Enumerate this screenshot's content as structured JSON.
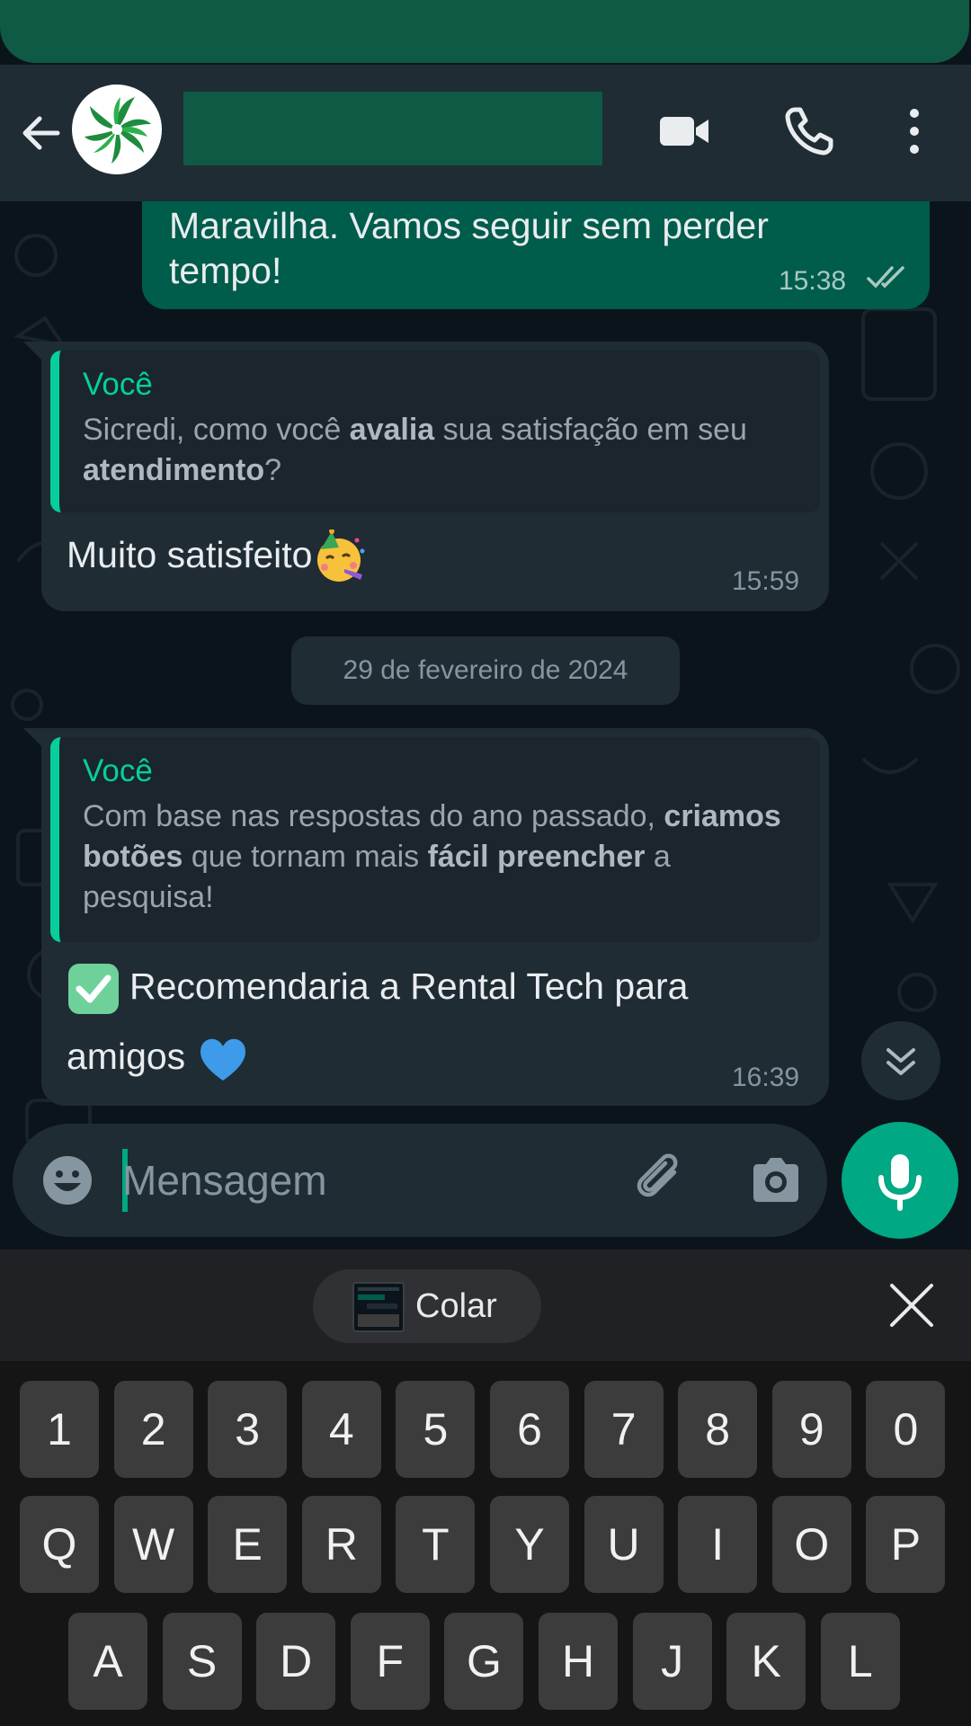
{
  "header": {
    "back_icon": "arrow-left-icon",
    "avatar_icon": "green-swirl-logo",
    "video_call_icon": "video-camera-icon",
    "voice_call_icon": "phone-icon",
    "more_icon": "three-dots-vertical-icon"
  },
  "messages": [
    {
      "type": "outgoing",
      "text": "Maravilha. Vamos seguir sem perder tempo!",
      "time": "15:38",
      "status_icon": "double-check-icon"
    },
    {
      "type": "incoming",
      "quote_author": "Você",
      "quote_parts": [
        {
          "t": "Sicredi, como você ",
          "b": false
        },
        {
          "t": "avalia",
          "b": true
        },
        {
          "t": " sua satisfação em seu ",
          "b": false
        },
        {
          "t": "atendimento",
          "b": true
        },
        {
          "t": "?",
          "b": false
        }
      ],
      "text": "Muito satisfeito",
      "emoji": "partying-face-emoji",
      "time": "15:59"
    },
    {
      "type": "incoming",
      "quote_author": "Você",
      "quote_parts": [
        {
          "t": "Com base nas respostas do ano passado, ",
          "b": false
        },
        {
          "t": "criamos botões",
          "b": true
        },
        {
          "t": " que tornam mais ",
          "b": false
        },
        {
          "t": "fácil preencher",
          "b": true
        },
        {
          "t": " a pesquisa!",
          "b": false
        }
      ],
      "leading_emoji": "check-mark-button-emoji",
      "text": "Recomendaria a Rental Tech para amigos",
      "emoji": "blue-heart-emoji",
      "time": "16:39"
    }
  ],
  "date_separator": "29 de fevereiro de 2024",
  "composer": {
    "placeholder": "Mensagem",
    "emoji_icon": "smiley-icon",
    "attach_icon": "paperclip-icon",
    "camera_icon": "camera-icon",
    "mic_icon": "microphone-icon",
    "scroll_down_icon": "double-chevron-down-icon"
  },
  "clipboard": {
    "paste_label": "Colar",
    "close_icon": "close-icon"
  },
  "keyboard": {
    "numbers": [
      "1",
      "2",
      "3",
      "4",
      "5",
      "6",
      "7",
      "8",
      "9",
      "0"
    ],
    "row1": [
      "Q",
      "W",
      "E",
      "R",
      "T",
      "Y",
      "U",
      "I",
      "O",
      "P"
    ],
    "row2": [
      "A",
      "S",
      "D",
      "F",
      "G",
      "H",
      "J",
      "K",
      "L"
    ]
  },
  "colors": {
    "accent": "#00a884",
    "outgoing_bubble": "#005c4b",
    "incoming_bubble": "#1f2c34",
    "background": "#0b141a"
  }
}
